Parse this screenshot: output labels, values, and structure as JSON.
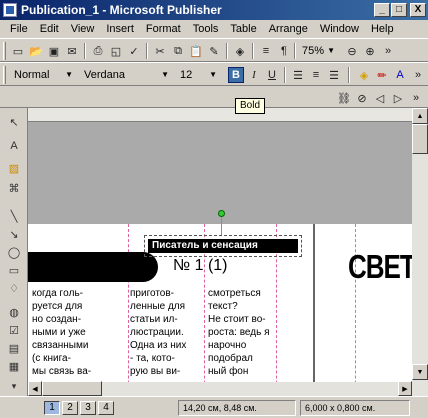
{
  "window": {
    "title": "Publication_1 - Microsoft Publisher",
    "minimize": "_",
    "maximize": "□",
    "close": "X"
  },
  "menu": [
    "File",
    "Edit",
    "View",
    "Insert",
    "Format",
    "Tools",
    "Table",
    "Arrange",
    "Window",
    "Help"
  ],
  "standard_toolbar": {
    "zoom": "75%"
  },
  "formatting_toolbar": {
    "style": "Normal",
    "font": "Verdana",
    "size": "12",
    "bold": "B",
    "italic": "I",
    "underline": "U"
  },
  "tooltip": "Bold",
  "document": {
    "headline": "Писатель и сенсация",
    "issue": "№ 1 (1)",
    "masthead": "СВЕТ Р",
    "columns": [
      [
        "когда гoль-",
        "руется для",
        "но создан-",
        "ными и уже",
        "связанными",
        "(с книга-",
        "мы связь ва-"
      ],
      [
        "приготов-",
        "ленные для",
        "статьи ил-",
        "люстрации.",
        "Одна из них",
        "- та, кото-",
        "рую вы ви-"
      ],
      [
        "смотреться",
        "текст?",
        "Не стоит во-",
        "роста: ведь я",
        "нарочно",
        "подобрал",
        "ный фон"
      ]
    ]
  },
  "status": {
    "pages": [
      "1",
      "2",
      "3",
      "4"
    ],
    "active_page": "1",
    "position": "14,20 см, 8,48 см.",
    "size": "6,000 x 0,800 см."
  },
  "colors": {
    "title_start": "#0a246a",
    "title_end": "#3a6ea5",
    "chrome": "#d4d0c8",
    "workspace": "#aaaaaa"
  }
}
